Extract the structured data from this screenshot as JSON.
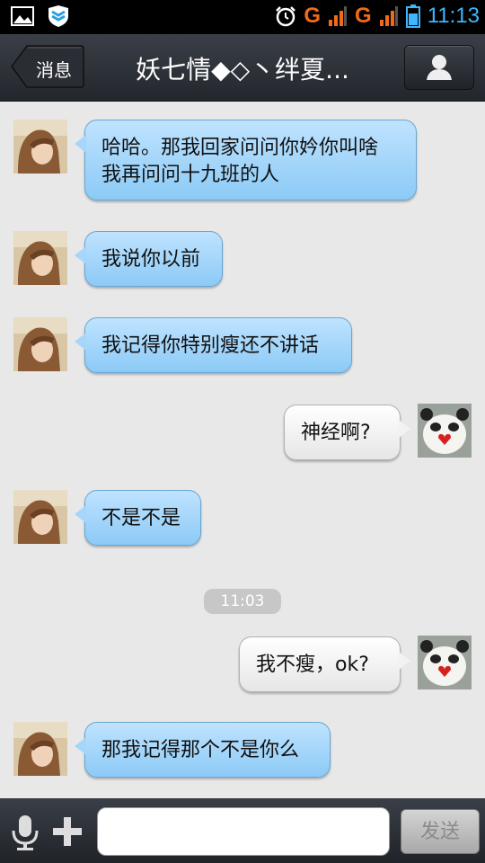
{
  "status_bar": {
    "net1": "G",
    "net2": "G",
    "time": "11:13",
    "icons": [
      "gallery-icon",
      "shield-icon",
      "alarm-icon",
      "signal-icon",
      "battery-icon"
    ]
  },
  "header": {
    "back_label": "消息",
    "title": "妖七情◆◇丶绊夏...",
    "profile_icon": "profile-icon"
  },
  "messages": [
    {
      "side": "in",
      "text_lines": [
        "哈哈。那我回家问问你妗你叫啥",
        "我再问问十九班的人"
      ]
    },
    {
      "side": "in",
      "text": "我说你以前"
    },
    {
      "side": "in",
      "text": "我记得你特别瘦还不讲话"
    },
    {
      "side": "out",
      "text": "神经啊?"
    },
    {
      "side": "in",
      "text": "不是不是"
    },
    {
      "side": "time",
      "text": "11:03"
    },
    {
      "side": "out",
      "text": "我不瘦，ok?"
    },
    {
      "side": "in",
      "text": "那我记得那个不是你么"
    }
  ],
  "composer": {
    "input_value": "",
    "send_label": "发送"
  },
  "colors": {
    "incoming_bubble": "#a6d6fb",
    "outgoing_bubble": "#f2f2f2",
    "accent_time": "#3fb6ff",
    "network_orange": "#f06a1a"
  }
}
